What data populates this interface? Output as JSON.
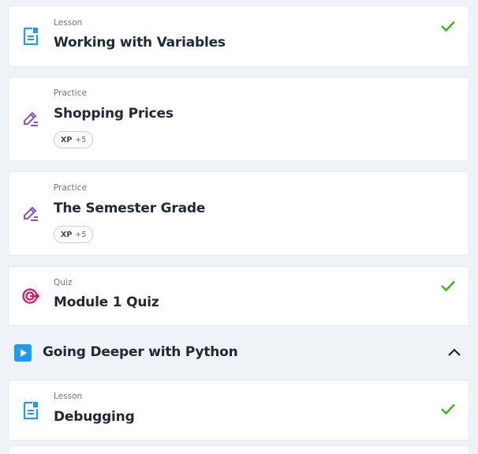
{
  "items": [
    {
      "type": "Lesson",
      "title": "Working with Variables",
      "icon": "lesson-doc-icon",
      "completed": true
    },
    {
      "type": "Practice",
      "title": "Shopping Prices",
      "icon": "practice-pencil-icon",
      "xp_label": "XP",
      "xp_value": "+5"
    },
    {
      "type": "Practice",
      "title": "The Semester Grade",
      "icon": "practice-pencil-icon",
      "xp_label": "XP",
      "xp_value": "+5"
    },
    {
      "type": "Quiz",
      "title": "Module 1 Quiz",
      "icon": "quiz-target-icon",
      "completed": true
    }
  ],
  "section": {
    "title": "Going Deeper with Python",
    "icon": "play-icon",
    "expanded": true
  },
  "section_items": [
    {
      "type": "Lesson",
      "title": "Debugging",
      "icon": "lesson-doc-icon",
      "completed": true
    }
  ],
  "colors": {
    "lesson": "#1f9bf0",
    "practice": "#8a4fd6",
    "quiz": "#e1125f",
    "check": "#3fb618",
    "background": "#eff2f6"
  }
}
